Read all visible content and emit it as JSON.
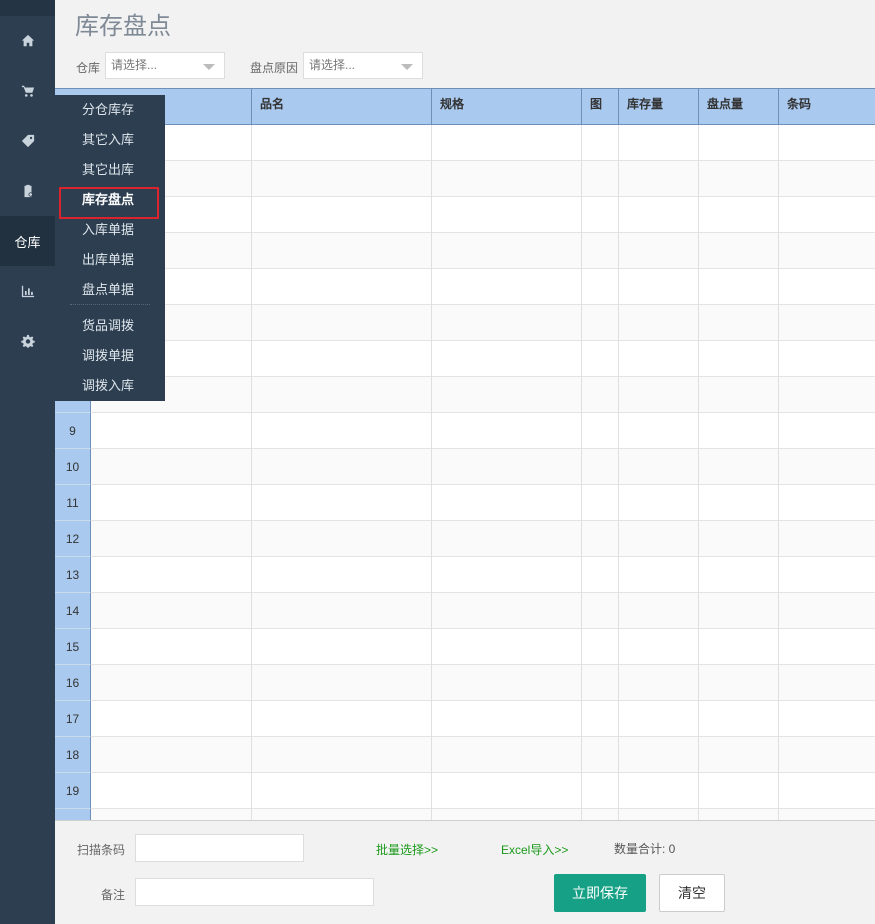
{
  "page_title": "库存盘点",
  "filters": {
    "warehouse_label": "仓库",
    "warehouse_value": "请选择...",
    "reason_label": "盘点原因",
    "reason_value": "请选择..."
  },
  "rail": {
    "items": [
      {
        "icon": "home-icon"
      },
      {
        "icon": "cart-icon"
      },
      {
        "icon": "tag-icon"
      },
      {
        "icon": "clipboard-icon"
      },
      {
        "label": "仓库"
      },
      {
        "icon": "bar-chart-icon"
      },
      {
        "icon": "gear-icon"
      }
    ]
  },
  "menu": {
    "items": [
      "分仓库存",
      "其它入库",
      "其它出库",
      "库存盘点",
      "入库单据",
      "出库单据",
      "盘点单据",
      "货品调拨",
      "调拨单据",
      "调拨入库"
    ],
    "current": "库存盘点"
  },
  "table": {
    "columns": [
      "品名",
      "规格",
      "图",
      "库存量",
      "盘点量",
      "条码"
    ],
    "row_numbers": [
      "9",
      "10",
      "11",
      "12",
      "13",
      "14",
      "15",
      "16",
      "17",
      "18",
      "19"
    ]
  },
  "footer": {
    "scan_label": "扫描条码",
    "batch_link": "批量选择>>",
    "excel_link": "Excel导入>>",
    "total_label": "数量合计: 0",
    "note_label": "备注",
    "save_button": "立即保存",
    "clear_button": "清空"
  },
  "colors": {
    "rail_bg": "#2d3e50",
    "header_bg": "#a9c9ef",
    "save_bg": "#16a085",
    "link_green": "#1a9a1a",
    "highlight_red": "#d9232d"
  }
}
